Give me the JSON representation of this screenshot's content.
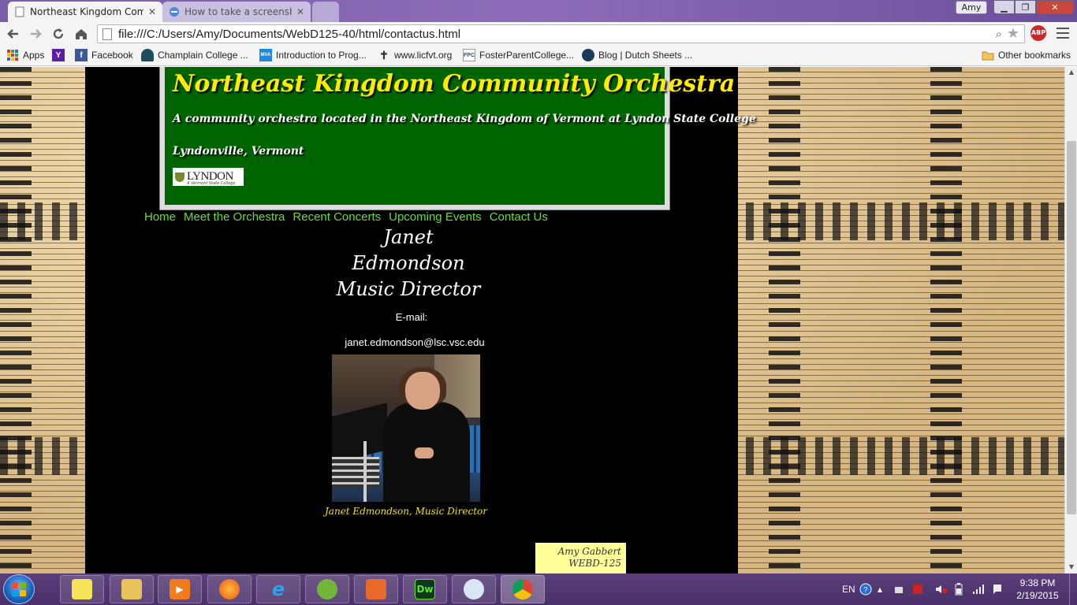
{
  "browser": {
    "tabs": [
      {
        "title": "Northeast Kingdom Comr",
        "active": true
      },
      {
        "title": "How to take a screenshot",
        "active": false
      }
    ],
    "user": "Amy",
    "url": "file:///C:/Users/Amy/Documents/WebD125-40/html/contactus.html",
    "abp_label": "ABP"
  },
  "bookmarks": {
    "items": [
      {
        "label": "Apps",
        "icon": "apps-grid-icon"
      },
      {
        "label": "",
        "icon": "yahoo-icon"
      },
      {
        "label": "Facebook",
        "icon": "facebook-icon"
      },
      {
        "label": "Champlain College ...",
        "icon": "champlain-icon"
      },
      {
        "label": "Introduction to Prog...",
        "icon": "mva-icon"
      },
      {
        "label": "www.licfvt.org",
        "icon": "cross-icon"
      },
      {
        "label": "FosterParentCollege...",
        "icon": "fpc-icon"
      },
      {
        "label": "Blog | Dutch Sheets ...",
        "icon": "blog-icon"
      }
    ],
    "other": "Other bookmarks",
    "badges": {
      "yahoo": "Y",
      "facebook": "f",
      "mva": "MVA",
      "fpc": "FPC"
    }
  },
  "site": {
    "title": "Northeast Kingdom Community Orchestra",
    "tagline": "A community orchestra located in the Northeast Kingdom of Vermont at Lyndon State College",
    "location": "Lyndonville, Vermont",
    "logo": {
      "name": "LYNDON",
      "sub": "A Vermont State College"
    },
    "nav": [
      "Home",
      "Meet the Orchestra",
      "Recent Concerts",
      "Upcoming Events",
      "Contact Us"
    ]
  },
  "contact": {
    "name_line1": "Janet",
    "name_line2": "Edmondson",
    "role": "Music Director",
    "email_label": "E-mail:",
    "email": "janet.edmondson@lsc.vsc.edu",
    "photo_caption": "Janet Edmondson, Music Director"
  },
  "footer": {
    "author": "Amy Gabbert",
    "course": "WEBD-125"
  },
  "taskbar": {
    "apps": [
      "sticky-notes-icon",
      "file-explorer-icon",
      "media-player-icon",
      "firefox-icon",
      "internet-explorer-icon",
      "spotify-icon",
      "photo-app-icon",
      "dreamweaver-icon",
      "paint-icon",
      "chrome-icon"
    ],
    "dreamweaver_label": "Dw",
    "language": "EN",
    "time": "9:38 PM",
    "date": "2/19/2015"
  },
  "colors": {
    "header_green": "#006400",
    "title_yellow": "#ffeb00",
    "nav_green": "#66dd33",
    "caption_yellow": "#f3e214",
    "footer_note_bg": "#ffff99"
  }
}
